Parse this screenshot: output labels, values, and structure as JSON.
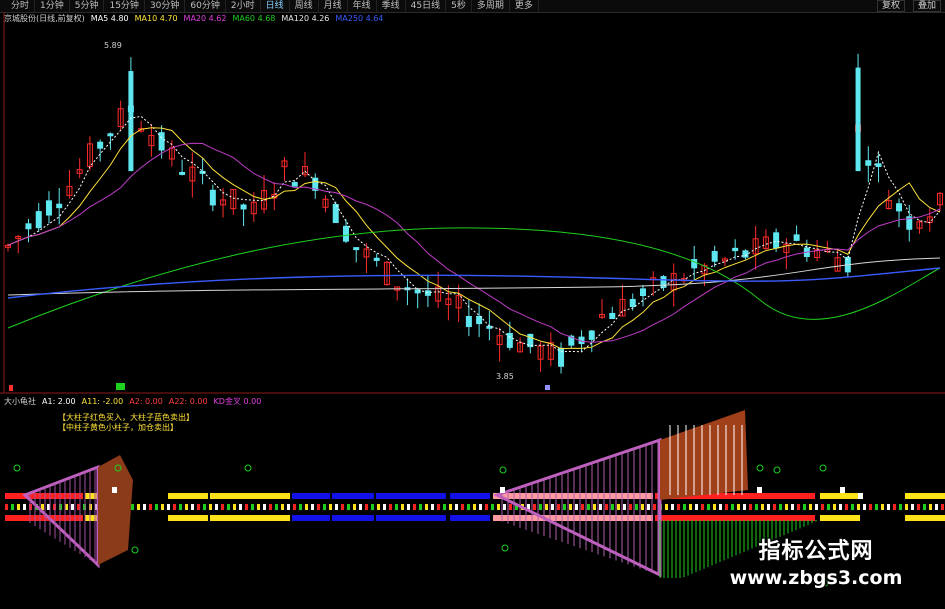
{
  "toolbar": {
    "tabs": [
      "分时",
      "1分钟",
      "5分钟",
      "15分钟",
      "30分钟",
      "60分钟",
      "2小时",
      "日线",
      "周线",
      "月线",
      "年线",
      "季线",
      "45日线",
      "5秒",
      "多周期",
      "更多"
    ],
    "active_tab": "日线",
    "right_buttons": [
      "复权",
      "叠加"
    ]
  },
  "legend_main": [
    {
      "text": "京城股份(日线,前复权)",
      "color": "#d0d0d0"
    },
    {
      "text": "MA5 4.80",
      "color": "#ffffff"
    },
    {
      "text": "MA10 4.70",
      "color": "#ffe23a"
    },
    {
      "text": "MA20 4.62",
      "color": "#e040e0"
    },
    {
      "text": "MA60 4.68",
      "color": "#1ecf1e"
    },
    {
      "text": "MA120 4.26",
      "color": "#e8e8e8"
    },
    {
      "text": "MA250 4.64",
      "color": "#3a5cff"
    }
  ],
  "legend_sub": [
    {
      "text": "大小龟社",
      "color": "#d0d0d0"
    },
    {
      "text": "A1: 2.00",
      "color": "#ffffff"
    },
    {
      "text": "A11: -2.00",
      "color": "#ffe23a"
    },
    {
      "text": "A2: 0.00",
      "color": "#ff4040"
    },
    {
      "text": "A22: 0.00",
      "color": "#ff4040"
    },
    {
      "text": "KD金叉 0.00",
      "color": "#e040e0"
    }
  ],
  "notes": [
    "【大柱子红色买入，大柱子蓝色卖出】",
    "【中柱子黄色小柱子，加仓卖出】"
  ],
  "annotations": {
    "high_label": "5.89",
    "low_label": "3.85"
  },
  "watermark": {
    "line1": "指标公式网",
    "line2": "www.zbgs3.com"
  },
  "colors": {
    "up": "#ff2a2a",
    "down": "#5fe7f0",
    "ma5": "#ffffff",
    "ma10": "#ffe23a",
    "ma20": "#c03cc8",
    "ma60": "#1ecf1e",
    "ma120": "#d8d8d8",
    "ma250": "#3a5cff"
  }
}
